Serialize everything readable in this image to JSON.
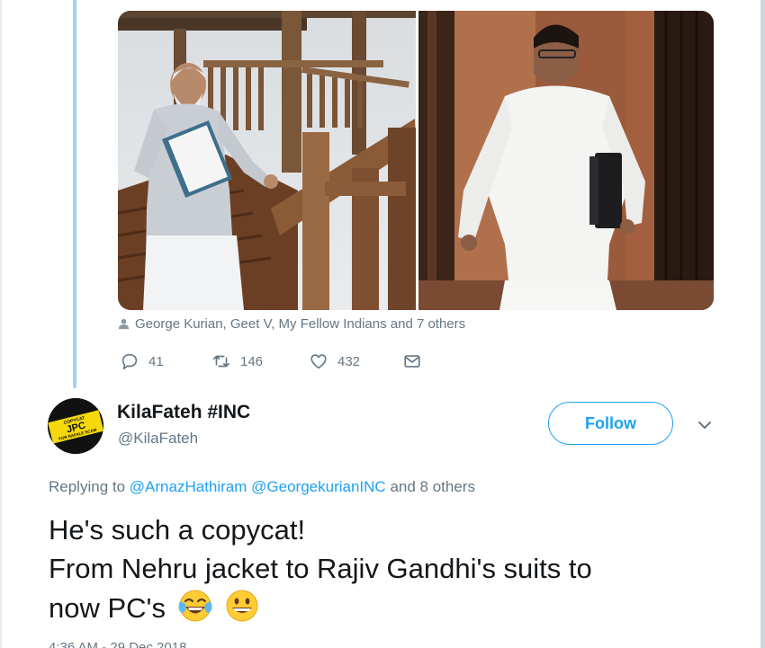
{
  "quoted_tweet": {
    "tagged_people": "George Kurian, Geet V, My Fellow Indians and 7 others",
    "actions": {
      "replies": "41",
      "retweets": "146",
      "likes": "432"
    }
  },
  "reply_tweet": {
    "avatar_text_lines": [
      "COPYCAT",
      "JPC",
      "FOR RAFALE SCAM"
    ],
    "display_name": "KilaFateh #INC",
    "handle": "@KilaFateh",
    "follow_label": "Follow",
    "replying_prefix": "Replying to",
    "replying_mention_1": "@ArnazHathiram",
    "replying_mention_2": "@GeorgekurianINC",
    "replying_suffix": "and 8 others",
    "text_line_1": "He's such a copycat!",
    "text_line_2": "From Nehru jacket to Rajiv Gandhi's suits to",
    "text_line_3": "now PC's",
    "emojis": [
      "face-with-tears-of-joy-emoji",
      "grinning-face-emoji"
    ],
    "timestamp": "4:36 AM - 29 Dec 2018"
  },
  "colors": {
    "accent": "#1da1f2",
    "thread_line": "#9ed3f6",
    "secondary_text": "#657786",
    "primary_text": "#14171a"
  }
}
